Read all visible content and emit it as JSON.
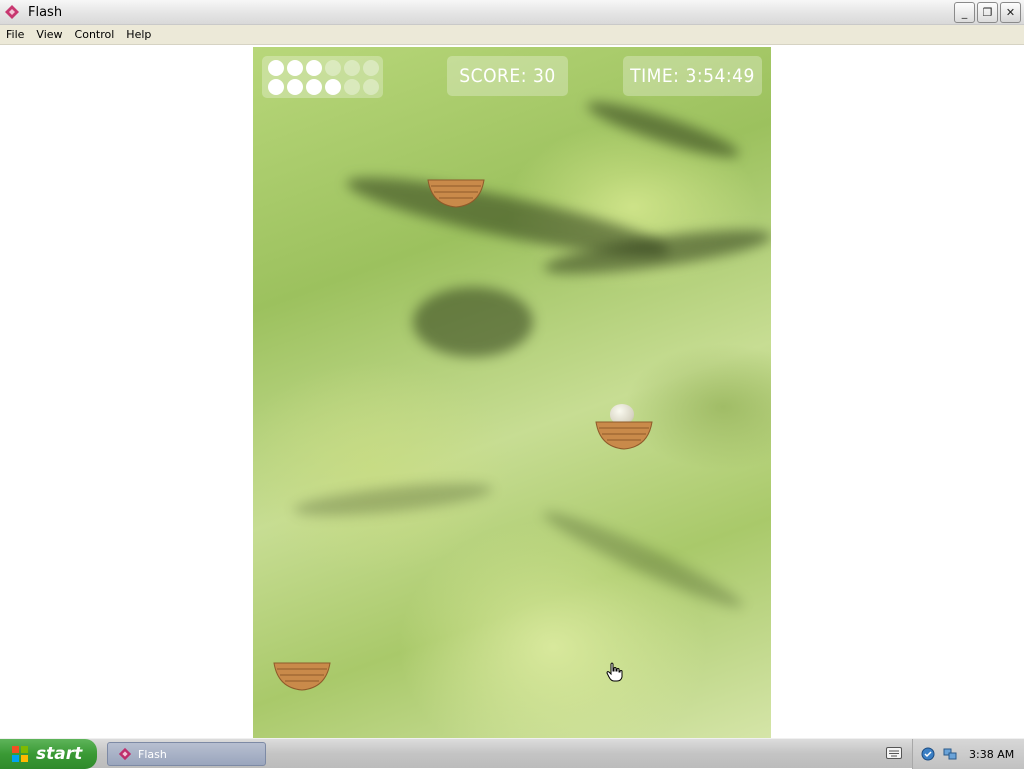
{
  "window": {
    "title": "Flash",
    "minimize_label": "_",
    "restore_label": "❐",
    "close_label": "✕"
  },
  "menu": [
    "File",
    "View",
    "Control",
    "Help"
  ],
  "game": {
    "lives_total": 12,
    "lives_remaining": 7,
    "score_label": "SCORE:",
    "score_value": "30",
    "time_label": "TIME:",
    "time_value": "3:54:49"
  },
  "taskbar": {
    "start_label": "start",
    "task_label": "Flash",
    "clock": "3:38 AM"
  },
  "colors": {
    "nest": "#c98a4a",
    "start_green": "#3a9a35"
  }
}
